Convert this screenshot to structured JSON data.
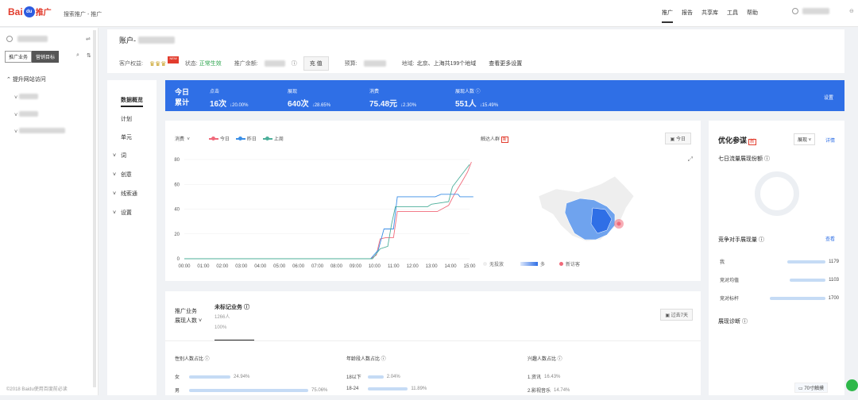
{
  "header": {
    "logo_text": "Bai",
    "logo_paw": "du",
    "logo_tg": "推广",
    "subtitle": "搜索推广 - 推广",
    "nav": [
      "推广",
      "报告",
      "共享库",
      "工具",
      "帮助"
    ]
  },
  "sidebar": {
    "tabs": [
      "推广业务",
      "营销目标"
    ],
    "goal": "提升网站访问",
    "footer": "©2018 Baidu使用百度前必读"
  },
  "account": {
    "title": "账户-",
    "rights_label": "客户权益:",
    "state_label": "状态:",
    "state_value": "正常生效",
    "balance_label": "推广余额:",
    "recharge_btn": "充 值",
    "budget_label": "预算:",
    "region_label": "地域:",
    "region_value": "北京、上海共199个地域",
    "more_settings": "查看更多设置",
    "new_badge": "NEW"
  },
  "leftnav": {
    "items": [
      "数据概览",
      "计划",
      "单元",
      "词",
      "创意",
      "线索通",
      "设置"
    ]
  },
  "summary": {
    "today": "今日",
    "total": "累计",
    "settings": "设置",
    "metrics": [
      {
        "label": "点击",
        "value": "16次",
        "change": "↓20.00%"
      },
      {
        "label": "展现",
        "value": "640次",
        "change": "↓28.65%"
      },
      {
        "label": "消费",
        "value": "75.48元",
        "change": "↓2.30%"
      },
      {
        "label": "展现人数 ⓘ",
        "value": "551人",
        "change": "↓15.49%"
      }
    ]
  },
  "trend": {
    "metric_select": "消费",
    "legend": [
      "今日",
      "昨日",
      "上周"
    ],
    "map_title": "触达人群",
    "map_badge": "新",
    "today_btn": "今日",
    "map_legend_none": "无投放",
    "map_legend_more": "多",
    "map_legend_visitor": "新访客"
  },
  "chart_data": {
    "type": "line",
    "x": [
      "00:00",
      "01:00",
      "02:00",
      "03:00",
      "04:00",
      "05:00",
      "06:00",
      "07:00",
      "08:00",
      "09:00",
      "10:00",
      "11:00",
      "12:00",
      "13:00",
      "14:00",
      "15:00"
    ],
    "ylim": [
      0,
      80
    ],
    "yticks": [
      0,
      20,
      40,
      60,
      80
    ],
    "series": [
      {
        "name": "今日",
        "color": "#f0697a",
        "values": [
          [
            0,
            0
          ],
          [
            9.8,
            0
          ],
          [
            10.1,
            3
          ],
          [
            10.3,
            16
          ],
          [
            10.6,
            17
          ],
          [
            11.0,
            17
          ],
          [
            11.2,
            38
          ],
          [
            13.0,
            38
          ],
          [
            13.3,
            38
          ],
          [
            13.9,
            43
          ],
          [
            14.2,
            52
          ],
          [
            14.6,
            62
          ],
          [
            14.9,
            70
          ],
          [
            15.1,
            78
          ]
        ]
      },
      {
        "name": "昨日",
        "color": "#3a8ee6",
        "values": [
          [
            0,
            0
          ],
          [
            9.8,
            0
          ],
          [
            10.2,
            7
          ],
          [
            10.5,
            24
          ],
          [
            11.0,
            24
          ],
          [
            11.2,
            50
          ],
          [
            13.2,
            50
          ],
          [
            13.5,
            52
          ],
          [
            14.4,
            52
          ],
          [
            14.5,
            50
          ],
          [
            15.2,
            50
          ]
        ]
      },
      {
        "name": "上周",
        "color": "#4caf9a",
        "values": [
          [
            0,
            0
          ],
          [
            9.9,
            0
          ],
          [
            10.3,
            8
          ],
          [
            10.7,
            10
          ],
          [
            10.9,
            28
          ],
          [
            11.1,
            42
          ],
          [
            12.8,
            42
          ],
          [
            13.0,
            44
          ],
          [
            13.9,
            46
          ],
          [
            14.1,
            58
          ],
          [
            14.5,
            66
          ],
          [
            14.8,
            72
          ],
          [
            15.0,
            76
          ]
        ]
      }
    ]
  },
  "optimize": {
    "title": "优化参谋",
    "badge": "新",
    "select": "展现",
    "detail": "详情",
    "share_title": "七日流量展现份额 ⓘ",
    "rivals_title": "竞争对手展现量 ⓘ",
    "rivals_link": "查看",
    "rivals": [
      {
        "name": "我",
        "value": "1179"
      },
      {
        "name": "竞对均值",
        "value": "1103"
      },
      {
        "name": "竞对标杆",
        "value": "1700"
      }
    ],
    "diag_title": "展现诊断 ⓘ",
    "chip": "70寸触摸"
  },
  "audience": {
    "left_line1": "推广业务",
    "left_line2": "展现人数",
    "tab_title": "未标记业务 ⓘ",
    "tab_count": "1266人",
    "tab_pct": "100%",
    "range_btn": "过去7天",
    "gender_title": "性别人数占比 ⓘ",
    "gender": [
      {
        "label": "女",
        "pct": "24.94%"
      },
      {
        "label": "男",
        "pct": "75.06%"
      }
    ],
    "age_title": "年龄段人数占比 ⓘ",
    "age": [
      {
        "label": "18以下",
        "pct": "2.04%"
      },
      {
        "label": "18-24",
        "pct": "11.89%"
      }
    ],
    "interest_title": "兴趣人数占比 ⓘ",
    "interest": [
      {
        "label": "1.资讯",
        "pct": "16.43%"
      },
      {
        "label": "2.影视音乐",
        "pct": "14.74%"
      }
    ]
  }
}
